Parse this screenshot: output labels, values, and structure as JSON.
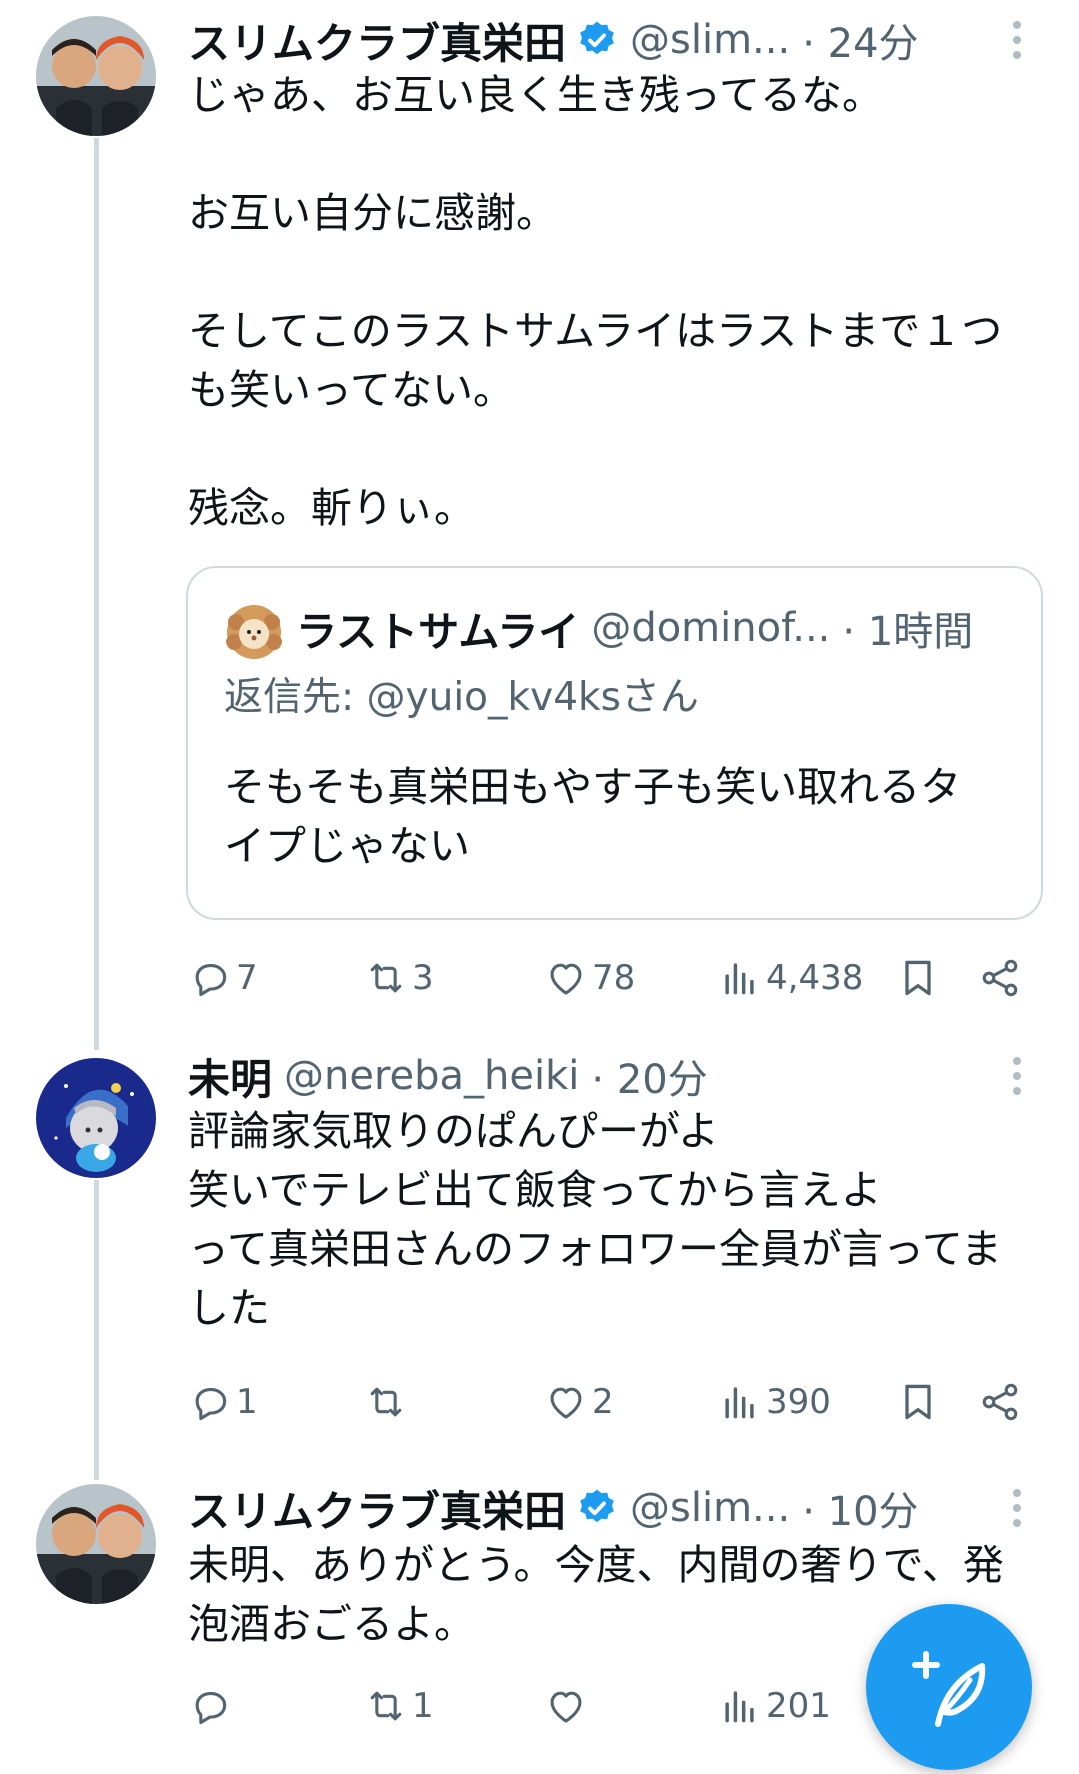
{
  "tweets": [
    {
      "name": "スリムクラブ真栄田",
      "handle": "@slim...",
      "time": "· 24分",
      "text": "じゃあ、お互い良く生き残ってるな。\n\nお互い自分に感謝。\n\nそしてこのラストサムライはラストまで１つも笑いってない。\n\n残念。斬りぃ。",
      "quote": {
        "name": "ラストサムライ",
        "handle": "@dominof...",
        "time": "· 1時間",
        "reply_to": "返信先: @yuio_kv4ksさん",
        "text": "そもそも真栄田もやす子も笑い取れるタイプじゃない"
      },
      "replies": "7",
      "retweets": "3",
      "likes": "78",
      "views": "4,438"
    },
    {
      "name": "未明",
      "handle": "@nereba_heiki",
      "time": "· 20分",
      "text": "評論家気取りのぱんぴーがよ\n笑いでテレビ出て飯食ってから言えよ\nって真栄田さんのフォロワー全員が言ってました",
      "replies": "1",
      "retweets": "",
      "likes": "2",
      "views": "390"
    },
    {
      "name": "スリムクラブ真栄田",
      "handle": "@slim...",
      "time": "· 10分",
      "text": "未明、ありがとう。今度、内間の奢りで、発泡酒おごるよ。",
      "replies": "",
      "retweets": "1",
      "likes": "",
      "views": "201"
    }
  ],
  "colors": {
    "accent": "#1d9bf0",
    "text": "#0f1419",
    "muted": "#536471",
    "border": "#cfd9de"
  }
}
